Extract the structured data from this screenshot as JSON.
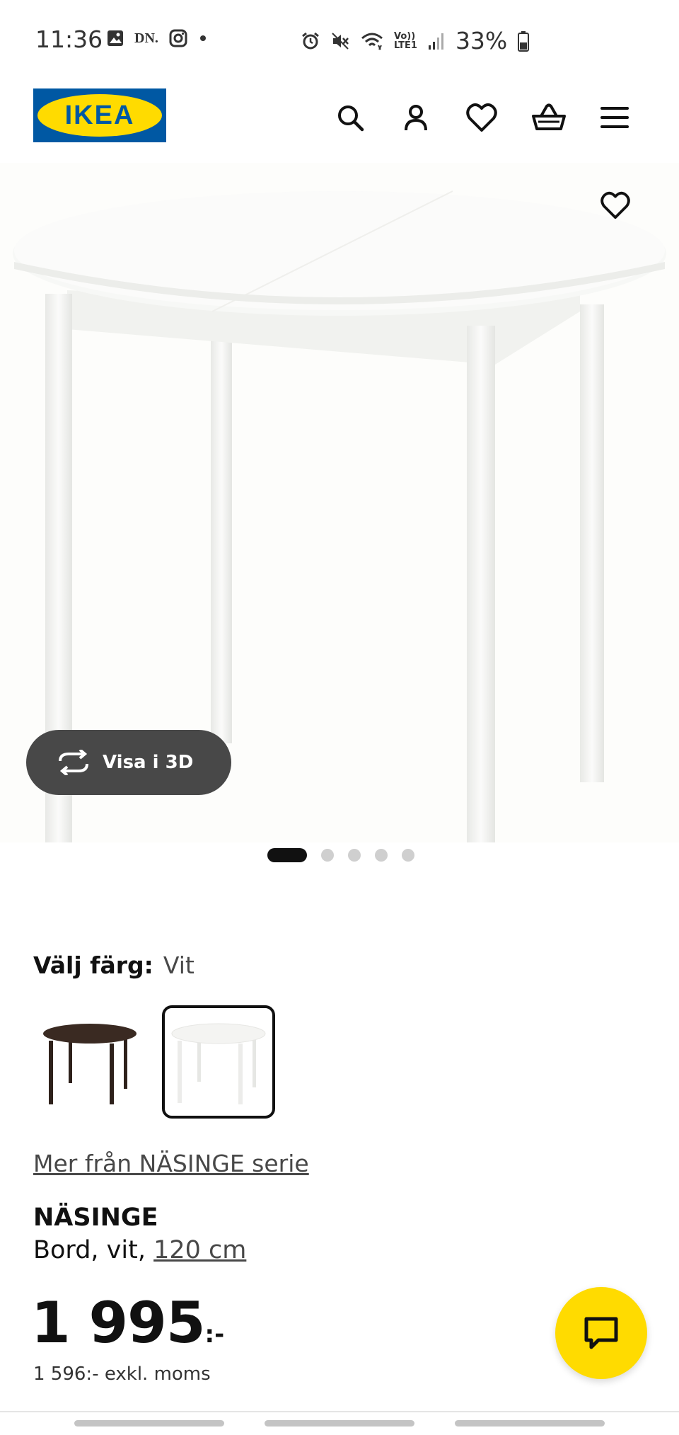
{
  "status_bar": {
    "time": "11:36",
    "battery": "33%",
    "left_icons": [
      "gallery-icon",
      "dn-app-icon",
      "instagram-icon",
      "dot-icon"
    ],
    "right_icons": [
      "alarm-icon",
      "mute-icon",
      "wifi-icon",
      "volte-icon",
      "signal-icon",
      "battery-icon"
    ],
    "dn_label": "DN.",
    "volte_label_top": "Vo))",
    "volte_label_bottom": "LTE1"
  },
  "header": {
    "logo_text": "IKEA",
    "brand_colors": {
      "blue": "#0058a3",
      "yellow": "#ffdb00"
    },
    "icons": [
      "search-icon",
      "account-icon",
      "wishlist-icon",
      "cart-icon",
      "menu-icon"
    ]
  },
  "product_image": {
    "view_3d_label": "Visa i 3D",
    "carousel": {
      "total": 5,
      "active_index": 0
    }
  },
  "color_picker": {
    "label": "Välj färg:",
    "selected": "Vit",
    "options": [
      {
        "name": "dark-brown",
        "color": "#3a2a22",
        "selected": false
      },
      {
        "name": "white",
        "color": "#f4f4f2",
        "selected": true
      }
    ]
  },
  "series_link": "Mer från NÄSINGE serie",
  "product": {
    "name": "NÄSINGE",
    "description_prefix": "Bord, vit, ",
    "size_link": "120 cm",
    "price": "1 995",
    "price_suffix": ":-",
    "price_excl": "1 596:- exkl. moms"
  },
  "chat": {
    "icon": "chat-icon",
    "accent": "#ffdb00"
  }
}
